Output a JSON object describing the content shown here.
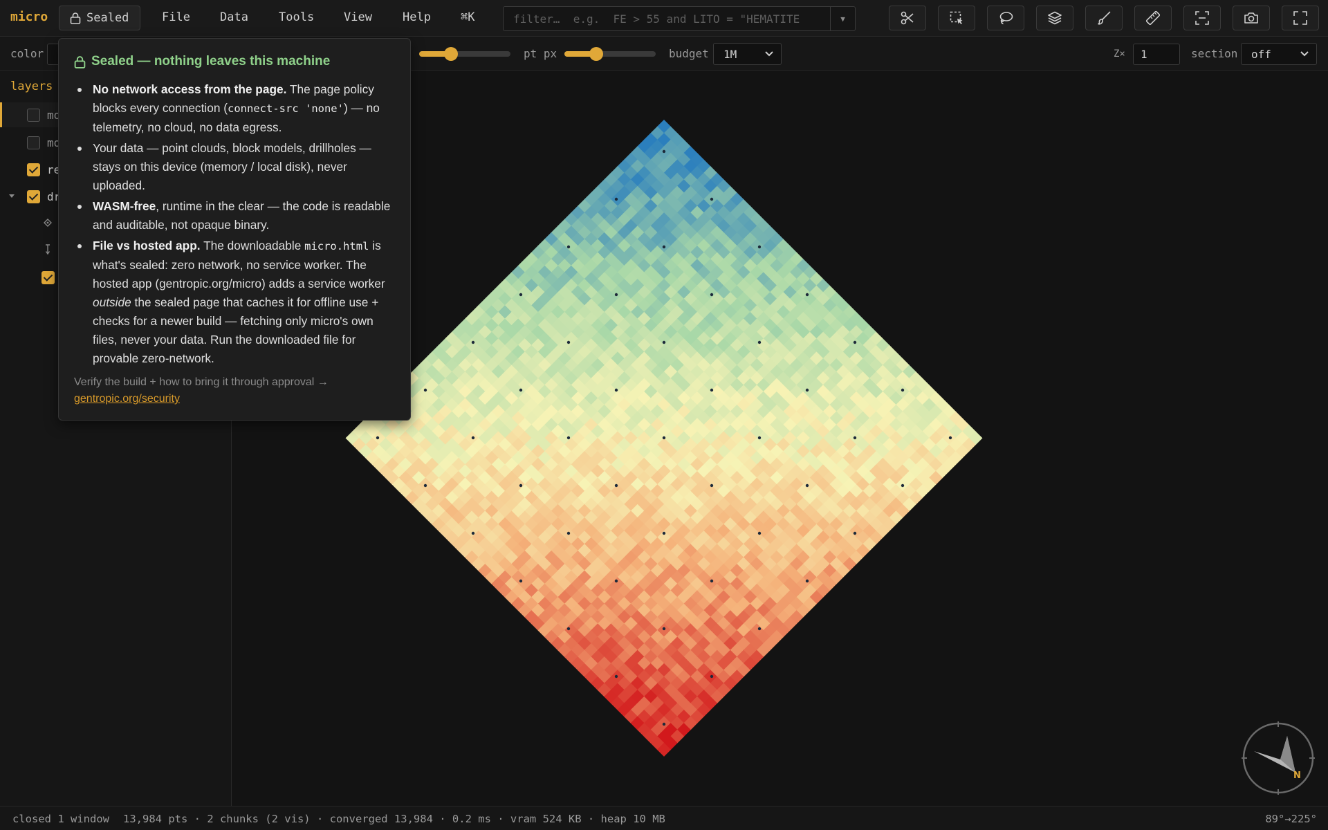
{
  "app": {
    "brand": "micro"
  },
  "menubar": {
    "sealed_label": "Sealed",
    "menus": [
      "File",
      "Data",
      "Tools",
      "View",
      "Help",
      "⌘K"
    ],
    "filter_placeholder": "filter…  e.g.  FE > 55 and LITO = \"HEMATITE",
    "tools": [
      "scissors-icon",
      "box-select-icon",
      "lasso-icon",
      "layers-icon",
      "brush-icon",
      "ruler-icon",
      "fit-view-icon",
      "camera-icon",
      "fullscreen-icon"
    ]
  },
  "toolbar2": {
    "color_label": "color",
    "size_label": "pt px",
    "size_slider_value": 0.33,
    "size_slider2_value": 0.33,
    "budget_label": "budget",
    "budget_value": "1M",
    "z_label": "Z×",
    "z_value": "1",
    "section_label": "section",
    "section_value": "off"
  },
  "sidebar": {
    "title": "layers",
    "rows": [
      {
        "label": "mo",
        "checked": false,
        "active": true
      },
      {
        "label": "mo",
        "checked": false,
        "active": false
      },
      {
        "label": "re",
        "checked": true,
        "active": false
      },
      {
        "label": "dr",
        "checked": true,
        "active": false
      }
    ]
  },
  "popover": {
    "title": "Sealed — nothing leaves this machine",
    "items": [
      {
        "bold": "No network access from the page.",
        "rest1": " The page policy blocks every connection (",
        "code": "connect-src 'none'",
        "rest2": ") — no telemetry, no cloud, no data egress."
      },
      {
        "text": "Your data — point clouds, block models, drillholes — stays on this device (memory / local disk), never uploaded."
      },
      {
        "bold": "WASM-free",
        "rest": ", runtime in the clear — the code is readable and auditable, not opaque binary."
      },
      {
        "bold": "File vs hosted app.",
        "rest1": " The downloadable ",
        "code": "micro.html",
        "rest2": " is what's sealed: zero network, no service worker. The hosted app (gentropic.org/micro) adds a service worker ",
        "em": "outside",
        "rest3": " the sealed page that caches it for offline use + checks for a newer build — fetching only micro's own files, never your data. Run the downloaded file for provable zero-network."
      }
    ],
    "footer": "Verify the build + how to bring it through approval →",
    "link": "gentropic.org/security"
  },
  "compass": {
    "north_label": "N"
  },
  "status": {
    "left": "closed 1 window",
    "stats": "13,984 pts · 2 chunks (2 vis) · converged 13,984 · 0.2 ms · vram 524 KB · heap 10 MB",
    "angle": "89°→225°"
  },
  "colors": {
    "accent": "#e0a838",
    "sealed_green": "#8fd18a",
    "ramp": [
      "#2b7fbd",
      "#a9d8a8",
      "#f7f3b5",
      "#f5b27a",
      "#d2191c"
    ]
  }
}
